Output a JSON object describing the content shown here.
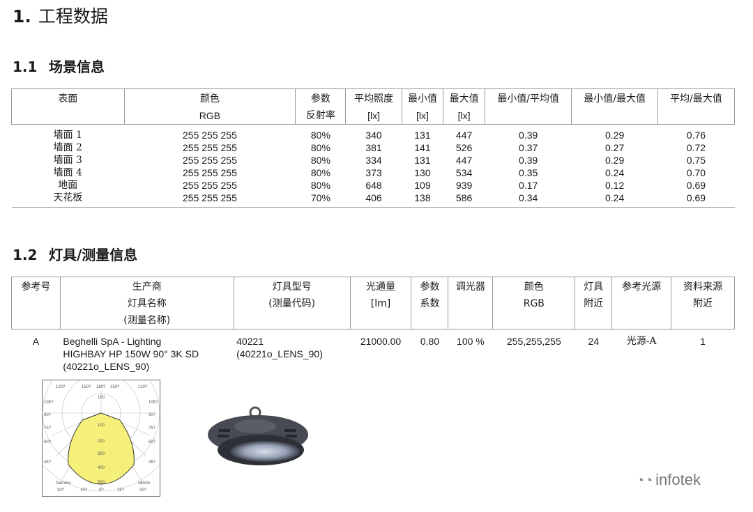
{
  "h1": {
    "num": "1.",
    "title": "工程数据"
  },
  "s1": {
    "num": "1.1",
    "title": "场景信息"
  },
  "t1": {
    "headers": [
      [
        "表面",
        ""
      ],
      [
        "颜色",
        "RGB"
      ],
      [
        "参数",
        "反射率"
      ],
      [
        "平均照度",
        "[lx]"
      ],
      [
        "最小值",
        "[lx]"
      ],
      [
        "最大值",
        "[lx]"
      ],
      [
        "最小值/平均值",
        ""
      ],
      [
        "最小值/最大值",
        ""
      ],
      [
        "平均/最大值",
        ""
      ]
    ],
    "rows": [
      [
        "墙面 1",
        "255 255 255",
        "80%",
        "340",
        "131",
        "447",
        "0.39",
        "0.29",
        "0.76"
      ],
      [
        "墙面 2",
        "255 255 255",
        "80%",
        "381",
        "141",
        "526",
        "0.37",
        "0.27",
        "0.72"
      ],
      [
        "墙面 3",
        "255 255 255",
        "80%",
        "334",
        "131",
        "447",
        "0.39",
        "0.29",
        "0.75"
      ],
      [
        "墙面 4",
        "255 255 255",
        "80%",
        "373",
        "130",
        "534",
        "0.35",
        "0.24",
        "0.70"
      ],
      [
        "地面",
        "255 255 255",
        "80%",
        "648",
        "109",
        "939",
        "0.17",
        "0.12",
        "0.69"
      ],
      [
        "天花板",
        "255 255 255",
        "70%",
        "406",
        "138",
        "586",
        "0.34",
        "0.24",
        "0.69"
      ]
    ]
  },
  "s2": {
    "num": "1.2",
    "title": "灯具/测量信息"
  },
  "t2": {
    "headers": [
      [
        "参考号",
        "",
        ""
      ],
      [
        "生产商",
        "灯具名称",
        "(测量名称)"
      ],
      [
        "灯具型号",
        "(测量代码)",
        ""
      ],
      [
        "光通量",
        "[lm]",
        ""
      ],
      [
        "参数",
        "系数",
        ""
      ],
      [
        "调光器",
        "",
        ""
      ],
      [
        "颜色",
        "RGB",
        ""
      ],
      [
        "灯具",
        "附近",
        ""
      ],
      [
        "参考光源",
        "",
        ""
      ],
      [
        "资料来源",
        "附近",
        ""
      ]
    ],
    "row": {
      "ref": "A",
      "maker": [
        "Beghelli SpA - Lighting",
        "HIGHBAY HP 150W 90° 3K SD",
        "(40221o_LENS_90)"
      ],
      "model": [
        "40221",
        "(40221o_LENS_90)"
      ],
      "flux": "21000.00",
      "factor": "0.80",
      "dimmer": "100 %",
      "rgb": "255,255,255",
      "near": "24",
      "source": "光源-A",
      "datasource": "1"
    }
  },
  "polar": {
    "top_labels": [
      "120?",
      "150?",
      "180?",
      "150?",
      "120?"
    ],
    "left_labels": [
      "105?",
      "90?",
      "75?",
      "60?",
      "45?"
    ],
    "right_labels": [
      "105?",
      "90?",
      "75?",
      "60?",
      "45?"
    ],
    "radial_labels": [
      "100",
      "100",
      "200",
      "300",
      "400",
      "500"
    ],
    "bottom_labels": [
      "30?",
      "15?",
      "0?",
      "15?",
      "30?"
    ],
    "gamma": "Gamma",
    "unit": "cd/klm"
  },
  "logo": "infotek",
  "colors": {
    "rule": "#999999",
    "beam": "#f5f07a",
    "text": "#1a1a1a"
  }
}
